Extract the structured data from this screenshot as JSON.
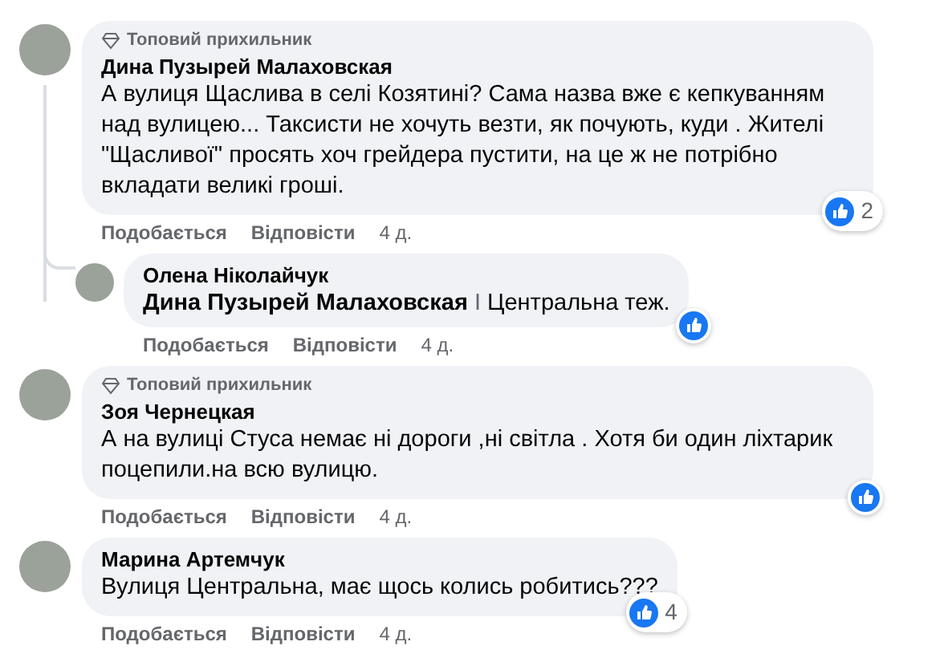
{
  "comments": [
    {
      "badge": "Топовий прихильник",
      "author": "Дина Пузырей Малаховская",
      "text": "А вулиця Щаслива в селі Козятині? Сама назва вже є кепкуванням над вулицею... Таксисти не хочуть везти, як почують, куди . Жителі \"Щасливої\" просять хоч грейдера пустити, на це ж не потрібно вкладати великі гроші.",
      "reaction_count": "2",
      "actions": [
        "Подобається",
        "Відповісти"
      ],
      "time": "4 д.",
      "children": [
        {
          "author": "Олена Ніколайчук",
          "mention": "Дина Пузырей Малаховская",
          "separator": "I",
          "text": "Центральна теж.",
          "actions": [
            "Подобається",
            "Відповісти"
          ],
          "time": "4 д."
        }
      ]
    },
    {
      "badge": "Топовий прихильник",
      "author": "Зоя Чернецкая",
      "text": "А на вулиці Стуса немає ні дороги ,ні світла . Хотя би один ліхтарик поцепили.на всю вулицю.",
      "actions": [
        "Подобається",
        "Відповісти"
      ],
      "time": "4 д."
    },
    {
      "author": "Марина Артемчук",
      "text": "Вулиця Центральна, має щось колись робитись???",
      "reaction_count": "4",
      "actions": [
        "Подобається",
        "Відповісти"
      ],
      "time": "4 д."
    }
  ]
}
